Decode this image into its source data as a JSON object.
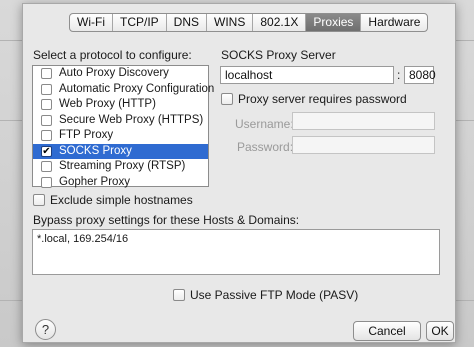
{
  "tabs": [
    {
      "label": "Wi-Fi"
    },
    {
      "label": "TCP/IP"
    },
    {
      "label": "DNS"
    },
    {
      "label": "WINS"
    },
    {
      "label": "802.1X"
    },
    {
      "label": "Proxies",
      "active": true
    },
    {
      "label": "Hardware"
    }
  ],
  "protocols": {
    "heading": "Select a protocol to configure:",
    "items": [
      {
        "label": "Auto Proxy Discovery",
        "checked": false
      },
      {
        "label": "Automatic Proxy Configuration",
        "checked": false
      },
      {
        "label": "Web Proxy (HTTP)",
        "checked": false
      },
      {
        "label": "Secure Web Proxy (HTTPS)",
        "checked": false
      },
      {
        "label": "FTP Proxy",
        "checked": false
      },
      {
        "label": "SOCKS Proxy",
        "checked": true,
        "selected": true
      },
      {
        "label": "Streaming Proxy (RTSP)",
        "checked": false
      },
      {
        "label": "Gopher Proxy",
        "checked": false
      }
    ]
  },
  "socks": {
    "heading": "SOCKS Proxy Server",
    "server": "localhost",
    "separator": ":",
    "port": "8080",
    "requires_password_label": "Proxy server requires password",
    "username_label": "Username:",
    "password_label": "Password:"
  },
  "exclude_simple_label": "Exclude simple hostnames",
  "bypass": {
    "label": "Bypass proxy settings for these Hosts & Domains:",
    "value": "*.local, 169.254/16"
  },
  "pasv_label": "Use Passive FTP Mode (PASV)",
  "buttons": {
    "help": "?",
    "cancel": "Cancel",
    "ok": "OK"
  },
  "colors": {
    "selection": "#2f6bd1",
    "active_tab": "#7a7a7a"
  }
}
